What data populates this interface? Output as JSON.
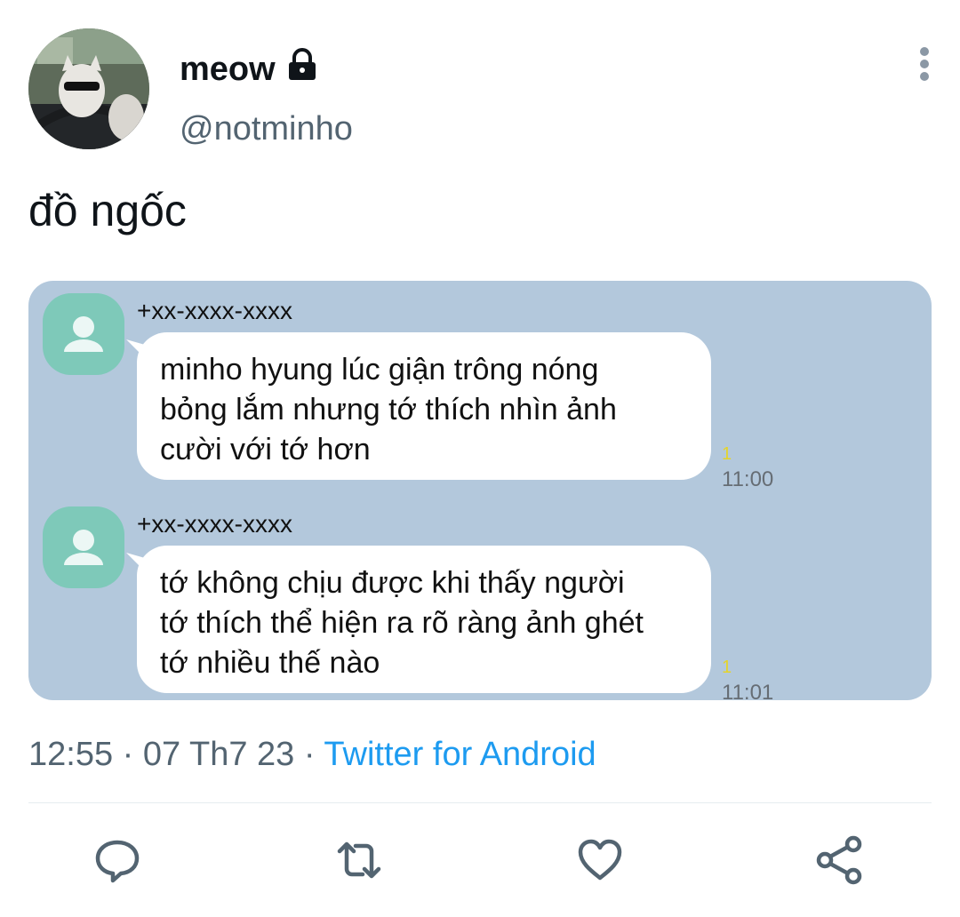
{
  "author": {
    "display_name": "meow",
    "handle": "@notminho",
    "lock_icon": "lock-icon",
    "avatar_desc": "cat-in-car-avatar"
  },
  "tweet": {
    "text": "đồ ngốc"
  },
  "media": {
    "messages": [
      {
        "sender": "+xx-xxxx-xxxx",
        "lines": [
          "minho hyung lúc giận trông nóng",
          "bỏng lắm nhưng tớ thích nhìn ảnh",
          "cười với tớ hơn"
        ],
        "unread": "1",
        "time": "11:00"
      },
      {
        "sender": "+xx-xxxx-xxxx",
        "lines": [
          "tớ không chịu được khi thấy người",
          "tớ thích thể hiện ra rõ ràng ảnh ghét",
          "tớ nhiều thế nào"
        ],
        "unread": "1",
        "time": "11:01"
      }
    ]
  },
  "meta": {
    "time": "12:55",
    "sep1": " · ",
    "date": "07 Th7 23",
    "sep2": " · ",
    "source": "Twitter for Android"
  },
  "actions": [
    "reply-icon",
    "retweet-icon",
    "like-icon",
    "share-icon"
  ],
  "colors": {
    "link": "#1d9bf0",
    "secondary_text": "#536471",
    "media_bg": "#b3c8dc",
    "contact_avatar": "#7ec9b9"
  }
}
